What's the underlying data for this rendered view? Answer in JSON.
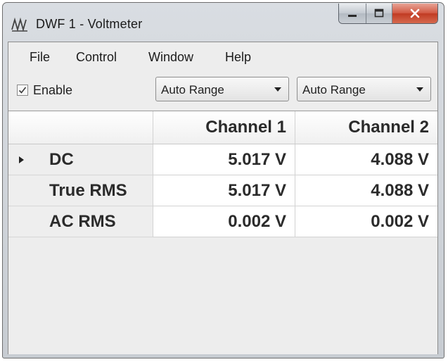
{
  "window": {
    "title": "DWF 1 - Voltmeter"
  },
  "menu": {
    "items": [
      "File",
      "Control",
      "Window",
      "Help"
    ]
  },
  "toolbar": {
    "enable_label": "Enable",
    "enable_checked": true,
    "channel1_range": "Auto Range",
    "channel2_range": "Auto Range"
  },
  "table": {
    "columns": [
      "Channel 1",
      "Channel 2"
    ],
    "rows": [
      {
        "label": "DC",
        "values": [
          "5.017 V",
          "4.088 V"
        ],
        "selected": true
      },
      {
        "label": "True RMS",
        "values": [
          "5.017 V",
          "4.088 V"
        ],
        "selected": false
      },
      {
        "label": "AC RMS",
        "values": [
          "0.002 V",
          "0.002 V"
        ],
        "selected": false
      }
    ]
  },
  "icons": {
    "app": "waveforms-logo-icon",
    "minimize": "minimize-icon",
    "maximize": "maximize-icon",
    "close": "close-icon",
    "checkbox": "checkmark-icon",
    "dropdown": "chevron-down-icon",
    "row_pointer": "row-pointer-icon"
  },
  "colors": {
    "close_button": "#c13b23",
    "titlebar": "#d9dde2",
    "grid_background": "#ededed"
  }
}
